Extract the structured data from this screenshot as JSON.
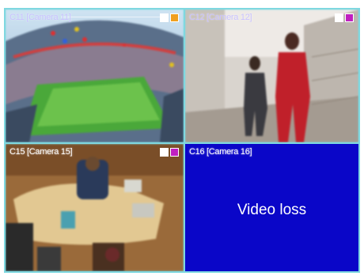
{
  "cameras": [
    {
      "label": "C11 [Camera 11]",
      "indicator_colors": [
        "#ffffff",
        "#f0a020"
      ]
    },
    {
      "label": "C12 [Camera 12]",
      "indicator_colors": [
        "#ffffff",
        "#c020c0"
      ]
    },
    {
      "label": "C15 [Camera 15]",
      "indicator_colors": [
        "#ffffff",
        "#c020c0"
      ]
    },
    {
      "label": "C16 [Camera 16]",
      "status": "Video loss"
    }
  ],
  "colors": {
    "grid_border": "#7fd8e0",
    "video_loss_bg": "#0a06c8"
  }
}
